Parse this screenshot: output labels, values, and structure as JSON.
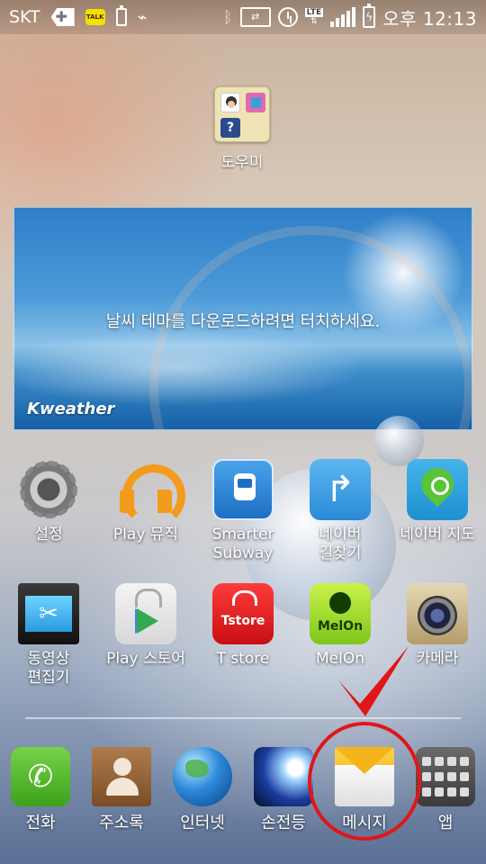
{
  "status_bar": {
    "carrier": "SKT",
    "talk_badge": "TALK",
    "network": "LTE",
    "time": "오후 12:13",
    "icons": [
      "plus-icon",
      "kakaotalk-icon",
      "battery-icon",
      "usb-icon",
      "bluetooth-icon",
      "nfc-icon",
      "alarm-icon",
      "lte-icon",
      "signal-icon",
      "battery-charging-icon"
    ]
  },
  "folder": {
    "label": "도우미"
  },
  "weather_widget": {
    "message": "날씨 테마를 다운로드하려면 터치하세요.",
    "brand": "Kweather"
  },
  "apps_row1": [
    {
      "label": "설정",
      "icon": "settings-icon"
    },
    {
      "label": "Play 뮤직",
      "icon": "play-music-icon"
    },
    {
      "label": "Smarter\nSubway",
      "icon": "subway-icon"
    },
    {
      "label": "네이버\n길찾기",
      "icon": "naver-route-icon"
    },
    {
      "label": "네이버 지도",
      "icon": "naver-map-icon"
    }
  ],
  "apps_row2": [
    {
      "label": "동영상\n편집기",
      "icon": "video-editor-icon"
    },
    {
      "label": "Play 스토어",
      "icon": "play-store-icon"
    },
    {
      "label": "T store",
      "icon": "tstore-icon",
      "icon_text": "Tstore"
    },
    {
      "label": "MelOn",
      "icon": "melon-icon",
      "icon_text": "MelOn"
    },
    {
      "label": "카메라",
      "icon": "camera-icon"
    }
  ],
  "dock": [
    {
      "label": "전화",
      "icon": "phone-icon"
    },
    {
      "label": "주소록",
      "icon": "contacts-icon"
    },
    {
      "label": "인터넷",
      "icon": "globe-icon"
    },
    {
      "label": "손전등",
      "icon": "flashlight-icon"
    },
    {
      "label": "메시지",
      "icon": "message-icon",
      "highlighted": true
    },
    {
      "label": "앱",
      "icon": "apps-grid-icon"
    }
  ],
  "colors": {
    "highlight": "#e11616",
    "weather_sky": "#2f7fc9"
  }
}
